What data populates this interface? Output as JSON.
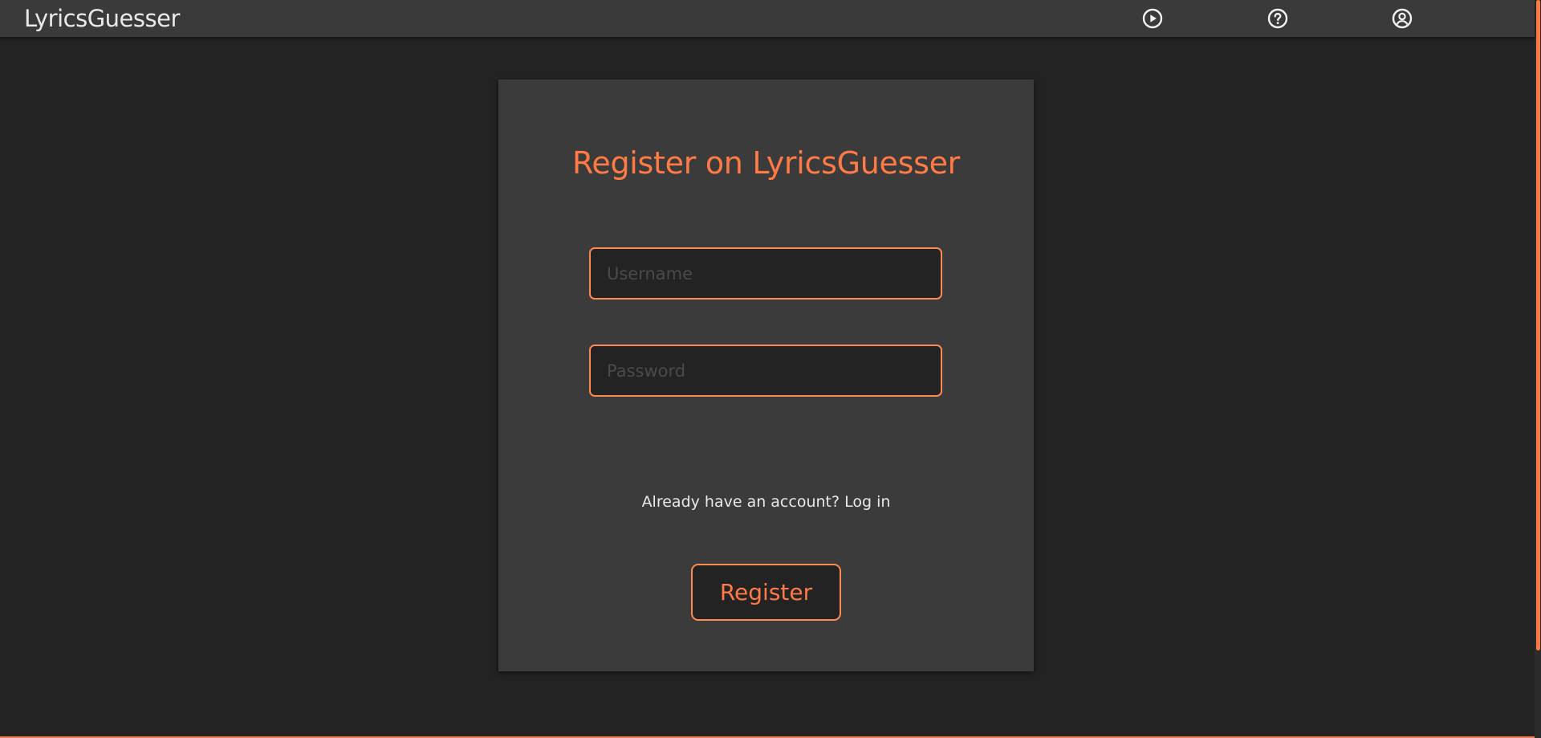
{
  "app": {
    "brand": "LyricsGuesser",
    "accent_color": "#ff7a45"
  },
  "nav": {
    "icons": [
      {
        "name": "play-circle-icon"
      },
      {
        "name": "help-circle-icon"
      },
      {
        "name": "user-circle-icon"
      }
    ]
  },
  "register": {
    "title": "Register on LyricsGuesser",
    "username_placeholder": "Username",
    "username_value": "",
    "password_placeholder": "Password",
    "password_value": "",
    "login_prompt": "Already have an account?",
    "login_link": "Log in",
    "submit_label": "Register"
  }
}
